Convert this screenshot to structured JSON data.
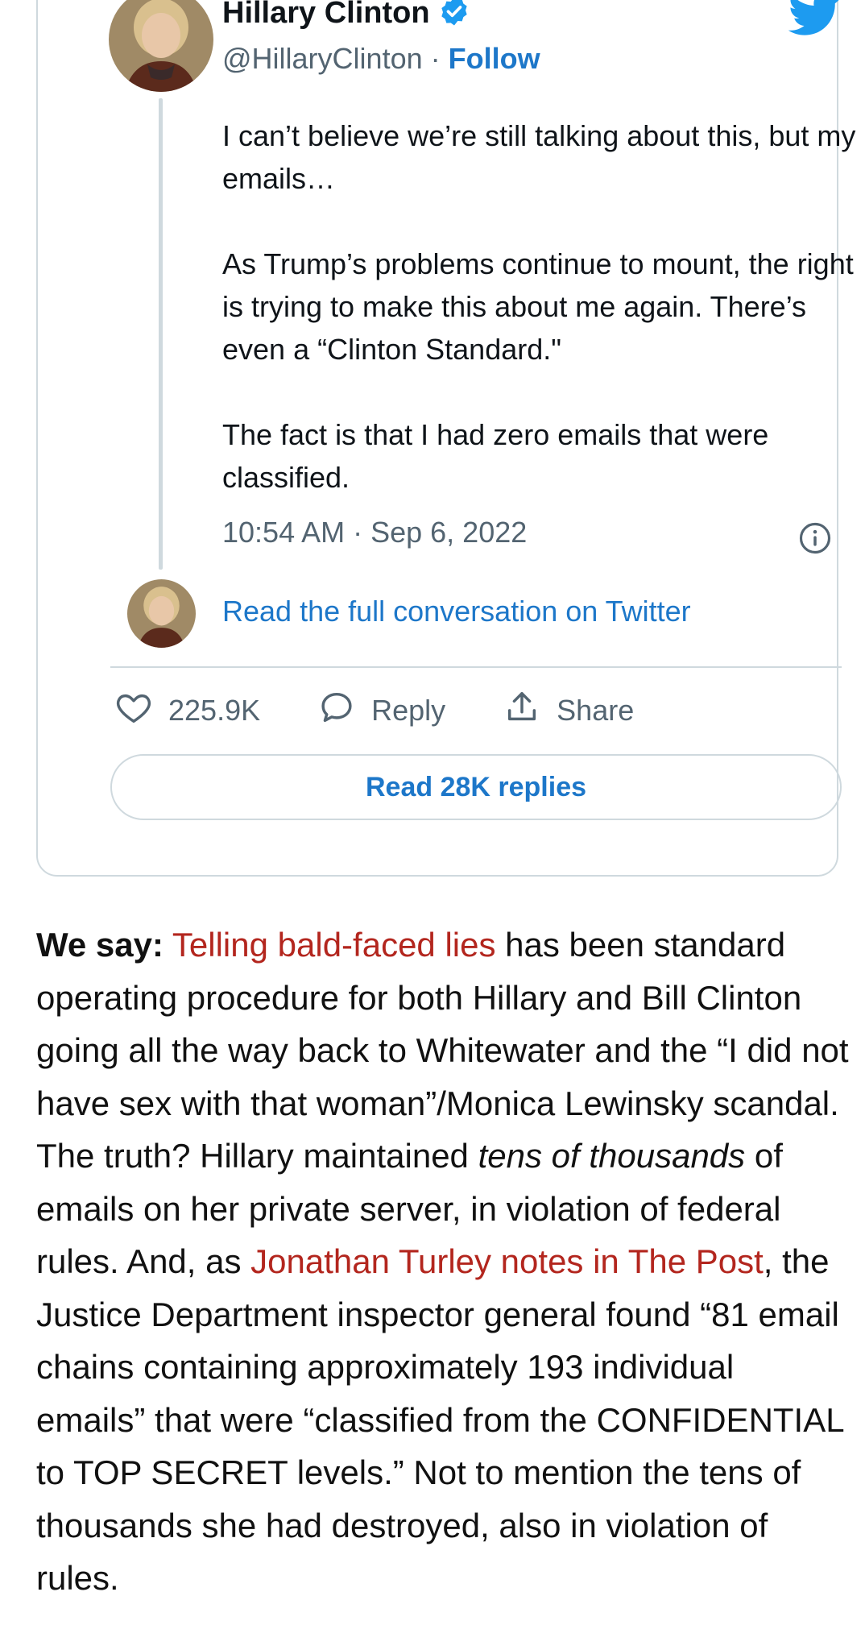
{
  "tweet": {
    "author_name": "Hillary Clinton",
    "handle": "@HillaryClinton",
    "separator": " · ",
    "follow_label": "Follow",
    "body": [
      "I can’t believe we’re still talking about this, but my emails…",
      "As Trump’s problems continue to mount, the right is trying to make this about me again. There’s even a “Clinton Standard.\"",
      "The fact is that I had zero emails that were classified."
    ],
    "timestamp": "10:54 AM · Sep 6, 2022",
    "read_full_label": "Read the full conversation on Twitter",
    "likes": "225.9K",
    "reply_label": "Reply",
    "share_label": "Share",
    "read_replies_label": "Read 28K replies",
    "icons": {
      "verified": "verified-badge-icon",
      "logo": "twitter-bird-icon",
      "info": "info-icon",
      "like": "heart-icon",
      "reply": "speech-bubble-icon",
      "share": "upload-share-icon"
    },
    "colors": {
      "link": "#1d77c9",
      "verified": "#1d9bf0",
      "muted": "#536471",
      "border": "#cfd9de"
    }
  },
  "article": {
    "lead": "We say:",
    "link1": "Telling bald-faced lies",
    "text1": " has been standard operating procedure for both Hillary and Bill Clinton going all the way back to Whitewater and the “I did not have sex with that woman”/Monica Lewinsky scandal. The truth? Hillary maintained ",
    "emphasis": "tens of thousands",
    "text2": " of emails on her private server, in violation of federal rules. And, as ",
    "link2": "Jonathan Turley notes in The Post",
    "text3": ", the Justice Department inspector general found “81 email chains containing approximately 193 individual emails” that were “classified from the CONFIDENTIAL to TOP SECRET levels.” Not to mention the tens of thousands she had destroyed, also in violation of rules.",
    "colors": {
      "link": "#b3261e"
    }
  }
}
